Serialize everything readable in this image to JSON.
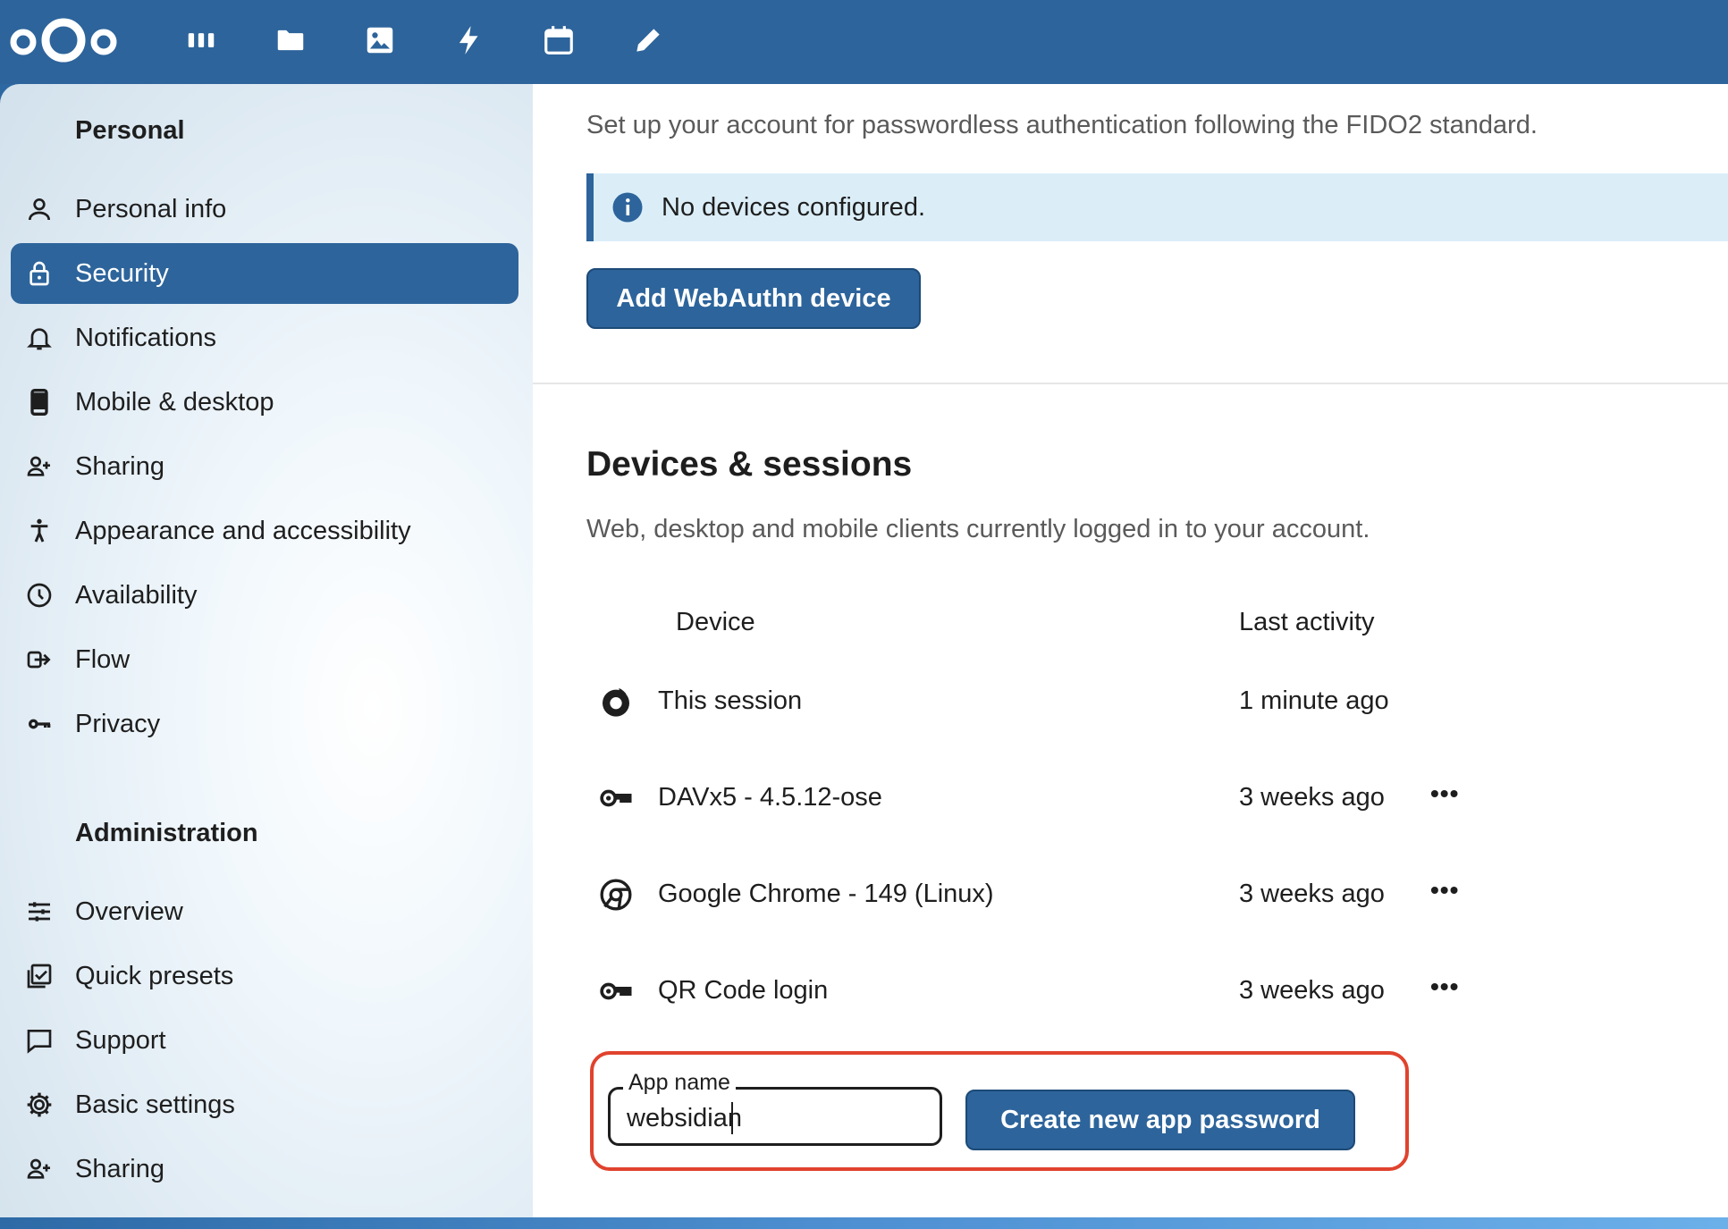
{
  "sidebar": {
    "personal_heading": "Personal",
    "admin_heading": "Administration",
    "personal_items": [
      {
        "label": "Personal info",
        "icon": "person-icon"
      },
      {
        "label": "Security",
        "icon": "lock-icon",
        "active": true
      },
      {
        "label": "Notifications",
        "icon": "bell-icon"
      },
      {
        "label": "Mobile & desktop",
        "icon": "phone-icon"
      },
      {
        "label": "Sharing",
        "icon": "share-person-icon"
      },
      {
        "label": "Appearance and accessibility",
        "icon": "accessibility-icon"
      },
      {
        "label": "Availability",
        "icon": "clock-icon"
      },
      {
        "label": "Flow",
        "icon": "flow-icon"
      },
      {
        "label": "Privacy",
        "icon": "key-icon"
      }
    ],
    "admin_items": [
      {
        "label": "Overview",
        "icon": "sliders-icon"
      },
      {
        "label": "Quick presets",
        "icon": "presets-icon"
      },
      {
        "label": "Support",
        "icon": "chat-icon"
      },
      {
        "label": "Basic settings",
        "icon": "gear-icon"
      },
      {
        "label": "Sharing",
        "icon": "share-person-icon"
      }
    ]
  },
  "webauthn": {
    "description": "Set up your account for passwordless authentication following the FIDO2 standard.",
    "info": "No devices configured.",
    "button": "Add WebAuthn device"
  },
  "devices": {
    "title": "Devices & sessions",
    "description": "Web, desktop and mobile clients currently logged in to your account.",
    "col_device": "Device",
    "col_activity": "Last activity",
    "rows": [
      {
        "name": "This session",
        "activity": "1 minute ago",
        "icon": "firefox-icon",
        "menu": ""
      },
      {
        "name": "DAVx5 - 4.5.12-ose",
        "activity": "3 weeks ago",
        "icon": "key-icon",
        "menu": "•••"
      },
      {
        "name": "Google Chrome - 149 (Linux)",
        "activity": "3 weeks ago",
        "icon": "chrome-icon",
        "menu": "•••"
      },
      {
        "name": "QR Code login",
        "activity": "3 weeks ago",
        "icon": "key-icon",
        "menu": "•••"
      }
    ]
  },
  "app_password": {
    "label": "App name",
    "value": "websidian",
    "button": "Create new app password"
  },
  "colors": {
    "brand": "#2d649b",
    "highlight": "#e0432e",
    "info_bg": "#dbeef8"
  }
}
